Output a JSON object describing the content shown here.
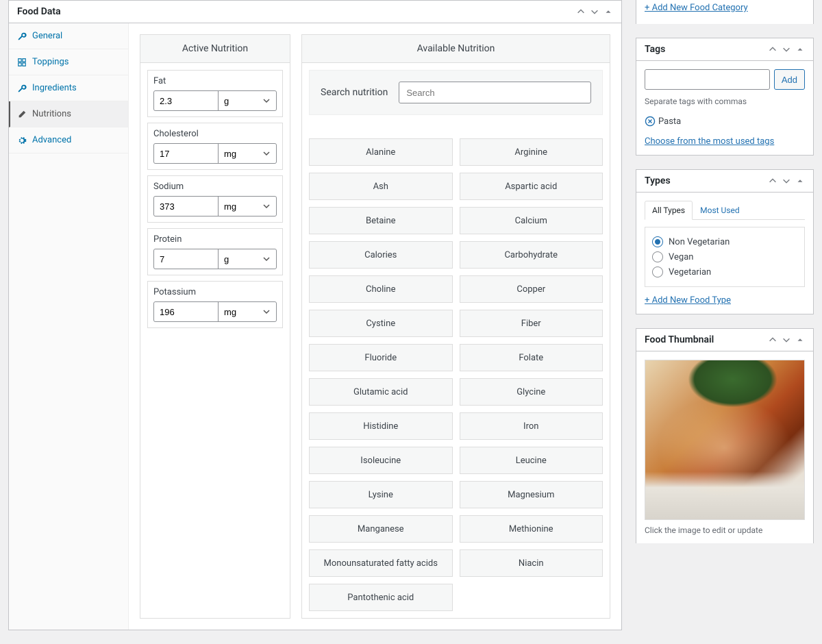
{
  "food_data": {
    "title": "Food Data",
    "tabs": [
      {
        "label": "General",
        "icon": "wrench"
      },
      {
        "label": "Toppings",
        "icon": "grid"
      },
      {
        "label": "Ingredients",
        "icon": "wrench"
      },
      {
        "label": "Nutritions",
        "icon": "pencil"
      },
      {
        "label": "Advanced",
        "icon": "gear"
      }
    ],
    "active_nutrition": {
      "header": "Active Nutrition",
      "items": [
        {
          "label": "Fat",
          "value": "2.3",
          "unit": "g"
        },
        {
          "label": "Cholesterol",
          "value": "17",
          "unit": "mg"
        },
        {
          "label": "Sodium",
          "value": "373",
          "unit": "mg"
        },
        {
          "label": "Protein",
          "value": "7",
          "unit": "g"
        },
        {
          "label": "Potassium",
          "value": "196",
          "unit": "mg"
        }
      ]
    },
    "available_nutrition": {
      "header": "Available Nutrition",
      "search_label": "Search nutrition",
      "search_placeholder": "Search",
      "items": [
        "Alanine",
        "Arginine",
        "Ash",
        "Aspartic acid",
        "Betaine",
        "Calcium",
        "Calories",
        "Carbohydrate",
        "Choline",
        "Copper",
        "Cystine",
        "Fiber",
        "Fluoride",
        "Folate",
        "Glutamic acid",
        "Glycine",
        "Histidine",
        "Iron",
        "Isoleucine",
        "Leucine",
        "Lysine",
        "Magnesium",
        "Manganese",
        "Methionine",
        "Monounsaturated fatty acids",
        "Niacin",
        "Pantothenic acid"
      ]
    }
  },
  "categories": {
    "add_link": "+ Add New Food Category"
  },
  "tags": {
    "title": "Tags",
    "add_button": "Add",
    "hint": "Separate tags with commas",
    "existing": [
      "Pasta"
    ],
    "choose_link": "Choose from the most used tags"
  },
  "types": {
    "title": "Types",
    "tab_all": "All Types",
    "tab_most": "Most Used",
    "options": [
      "Non Vegetarian",
      "Vegan",
      "Vegetarian"
    ],
    "selected": "Non Vegetarian",
    "add_link": "+ Add New Food Type"
  },
  "thumbnail": {
    "title": "Food Thumbnail",
    "hint": "Click the image to edit or update"
  }
}
